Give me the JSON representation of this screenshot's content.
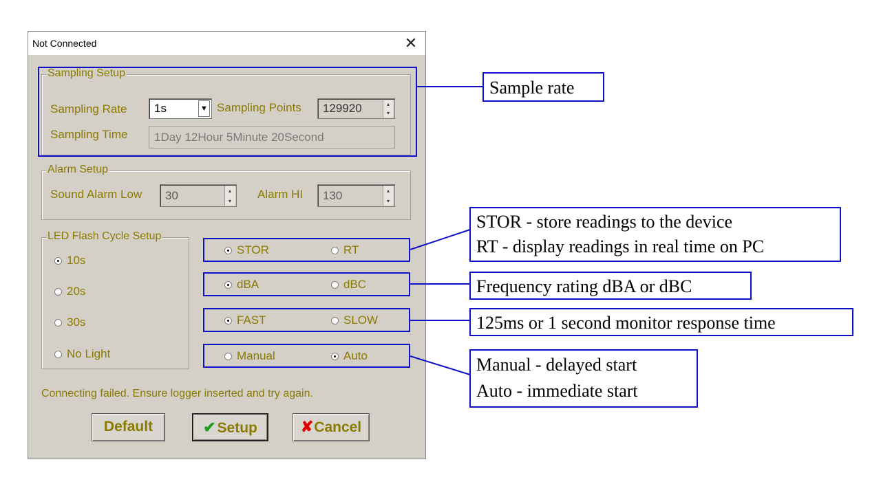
{
  "window": {
    "title": "Not Connected",
    "close_glyph": "✕"
  },
  "sampling_setup": {
    "title": "Sampling Setup",
    "rate_label": "Sampling Rate",
    "rate_value": "1s",
    "points_label": "Sampling Points",
    "points_value": "129920",
    "time_label": "Sampling Time",
    "time_value": "1Day 12Hour 5Minute 20Second"
  },
  "alarm_setup": {
    "title": "Alarm Setup",
    "low_label": "Sound Alarm Low",
    "low_value": "30",
    "hi_label": "Alarm HI",
    "hi_value": "130"
  },
  "led_setup": {
    "title": "LED Flash Cycle Setup",
    "options": [
      {
        "label": "10s",
        "selected": true
      },
      {
        "label": "20s",
        "selected": false
      },
      {
        "label": "30s",
        "selected": false
      },
      {
        "label": "No Light",
        "selected": false
      }
    ]
  },
  "radio_pairs": [
    {
      "left": "STOR",
      "right": "RT",
      "selected": "left"
    },
    {
      "left": "dBA",
      "right": "dBC",
      "selected": "left"
    },
    {
      "left": "FAST",
      "right": "SLOW",
      "selected": "left"
    },
    {
      "left": "Manual",
      "right": "Auto",
      "selected": "right"
    }
  ],
  "status_message": "Connecting failed. Ensure logger inserted and try again.",
  "buttons": {
    "default": "Default",
    "setup": "Setup",
    "cancel": "Cancel"
  },
  "callouts": {
    "sample_rate": "Sample rate",
    "stor_line1": "STOR - store readings to the device",
    "stor_line2": "RT - display readings in real time on PC",
    "frequency": "Frequency rating dBA or dBC",
    "response": "125ms or 1 second monitor response time",
    "manual_line1": "Manual - delayed start",
    "manual_line2": "Auto - immediate start"
  },
  "colors": {
    "label_olive": "#8b7a00",
    "annotation_blue": "#1010c8",
    "dialog_gray": "#d4d0c8"
  },
  "icons": {
    "close": "close-icon",
    "dropdown": "chevron-down-icon",
    "spinner": "spinner-arrows-icon",
    "setup": "checkmark-icon",
    "cancel": "x-mark-icon"
  }
}
